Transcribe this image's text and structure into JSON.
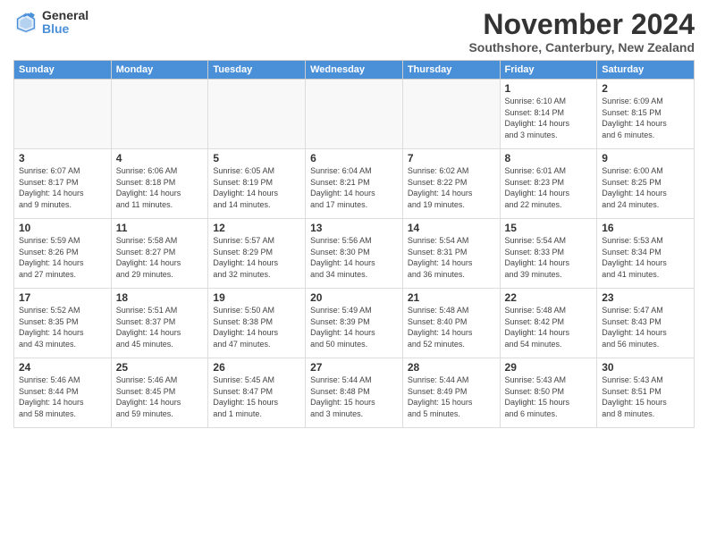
{
  "logo": {
    "general": "General",
    "blue": "Blue"
  },
  "title": "November 2024",
  "location": "Southshore, Canterbury, New Zealand",
  "headers": [
    "Sunday",
    "Monday",
    "Tuesday",
    "Wednesday",
    "Thursday",
    "Friday",
    "Saturday"
  ],
  "weeks": [
    [
      {
        "day": "",
        "info": ""
      },
      {
        "day": "",
        "info": ""
      },
      {
        "day": "",
        "info": ""
      },
      {
        "day": "",
        "info": ""
      },
      {
        "day": "",
        "info": ""
      },
      {
        "day": "1",
        "info": "Sunrise: 6:10 AM\nSunset: 8:14 PM\nDaylight: 14 hours\nand 3 minutes."
      },
      {
        "day": "2",
        "info": "Sunrise: 6:09 AM\nSunset: 8:15 PM\nDaylight: 14 hours\nand 6 minutes."
      }
    ],
    [
      {
        "day": "3",
        "info": "Sunrise: 6:07 AM\nSunset: 8:17 PM\nDaylight: 14 hours\nand 9 minutes."
      },
      {
        "day": "4",
        "info": "Sunrise: 6:06 AM\nSunset: 8:18 PM\nDaylight: 14 hours\nand 11 minutes."
      },
      {
        "day": "5",
        "info": "Sunrise: 6:05 AM\nSunset: 8:19 PM\nDaylight: 14 hours\nand 14 minutes."
      },
      {
        "day": "6",
        "info": "Sunrise: 6:04 AM\nSunset: 8:21 PM\nDaylight: 14 hours\nand 17 minutes."
      },
      {
        "day": "7",
        "info": "Sunrise: 6:02 AM\nSunset: 8:22 PM\nDaylight: 14 hours\nand 19 minutes."
      },
      {
        "day": "8",
        "info": "Sunrise: 6:01 AM\nSunset: 8:23 PM\nDaylight: 14 hours\nand 22 minutes."
      },
      {
        "day": "9",
        "info": "Sunrise: 6:00 AM\nSunset: 8:25 PM\nDaylight: 14 hours\nand 24 minutes."
      }
    ],
    [
      {
        "day": "10",
        "info": "Sunrise: 5:59 AM\nSunset: 8:26 PM\nDaylight: 14 hours\nand 27 minutes."
      },
      {
        "day": "11",
        "info": "Sunrise: 5:58 AM\nSunset: 8:27 PM\nDaylight: 14 hours\nand 29 minutes."
      },
      {
        "day": "12",
        "info": "Sunrise: 5:57 AM\nSunset: 8:29 PM\nDaylight: 14 hours\nand 32 minutes."
      },
      {
        "day": "13",
        "info": "Sunrise: 5:56 AM\nSunset: 8:30 PM\nDaylight: 14 hours\nand 34 minutes."
      },
      {
        "day": "14",
        "info": "Sunrise: 5:54 AM\nSunset: 8:31 PM\nDaylight: 14 hours\nand 36 minutes."
      },
      {
        "day": "15",
        "info": "Sunrise: 5:54 AM\nSunset: 8:33 PM\nDaylight: 14 hours\nand 39 minutes."
      },
      {
        "day": "16",
        "info": "Sunrise: 5:53 AM\nSunset: 8:34 PM\nDaylight: 14 hours\nand 41 minutes."
      }
    ],
    [
      {
        "day": "17",
        "info": "Sunrise: 5:52 AM\nSunset: 8:35 PM\nDaylight: 14 hours\nand 43 minutes."
      },
      {
        "day": "18",
        "info": "Sunrise: 5:51 AM\nSunset: 8:37 PM\nDaylight: 14 hours\nand 45 minutes."
      },
      {
        "day": "19",
        "info": "Sunrise: 5:50 AM\nSunset: 8:38 PM\nDaylight: 14 hours\nand 47 minutes."
      },
      {
        "day": "20",
        "info": "Sunrise: 5:49 AM\nSunset: 8:39 PM\nDaylight: 14 hours\nand 50 minutes."
      },
      {
        "day": "21",
        "info": "Sunrise: 5:48 AM\nSunset: 8:40 PM\nDaylight: 14 hours\nand 52 minutes."
      },
      {
        "day": "22",
        "info": "Sunrise: 5:48 AM\nSunset: 8:42 PM\nDaylight: 14 hours\nand 54 minutes."
      },
      {
        "day": "23",
        "info": "Sunrise: 5:47 AM\nSunset: 8:43 PM\nDaylight: 14 hours\nand 56 minutes."
      }
    ],
    [
      {
        "day": "24",
        "info": "Sunrise: 5:46 AM\nSunset: 8:44 PM\nDaylight: 14 hours\nand 58 minutes."
      },
      {
        "day": "25",
        "info": "Sunrise: 5:46 AM\nSunset: 8:45 PM\nDaylight: 14 hours\nand 59 minutes."
      },
      {
        "day": "26",
        "info": "Sunrise: 5:45 AM\nSunset: 8:47 PM\nDaylight: 15 hours\nand 1 minute."
      },
      {
        "day": "27",
        "info": "Sunrise: 5:44 AM\nSunset: 8:48 PM\nDaylight: 15 hours\nand 3 minutes."
      },
      {
        "day": "28",
        "info": "Sunrise: 5:44 AM\nSunset: 8:49 PM\nDaylight: 15 hours\nand 5 minutes."
      },
      {
        "day": "29",
        "info": "Sunrise: 5:43 AM\nSunset: 8:50 PM\nDaylight: 15 hours\nand 6 minutes."
      },
      {
        "day": "30",
        "info": "Sunrise: 5:43 AM\nSunset: 8:51 PM\nDaylight: 15 hours\nand 8 minutes."
      }
    ]
  ]
}
